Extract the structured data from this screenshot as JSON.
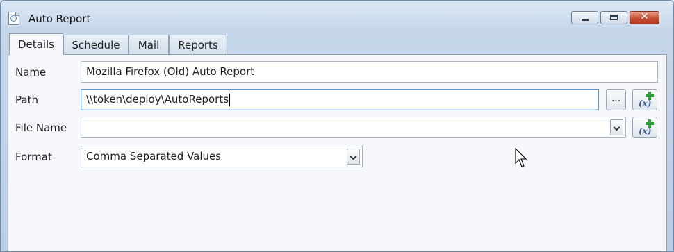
{
  "window": {
    "title": "Auto Report"
  },
  "tabs": [
    {
      "label": "Details",
      "active": true
    },
    {
      "label": "Schedule",
      "active": false
    },
    {
      "label": "Mail",
      "active": false
    },
    {
      "label": "Reports",
      "active": false
    }
  ],
  "form": {
    "name": {
      "label": "Name",
      "value": "Mozilla Firefox (Old) Auto Report"
    },
    "path": {
      "label": "Path",
      "value": "\\\\token\\deploy\\AutoReports",
      "browse_label": "..."
    },
    "file_name": {
      "label": "File Name",
      "value": ""
    },
    "format": {
      "label": "Format",
      "value": "Comma Separated Values"
    }
  },
  "colors": {
    "close_button": "#c24e33",
    "accent": "#5b8fc7",
    "insert_variable_plus": "#2e9d3e"
  },
  "icons": [
    "report-app-icon",
    "minimize-icon",
    "maximize-icon",
    "close-icon",
    "insert-variable-icon",
    "mouse-pointer-icon"
  ]
}
